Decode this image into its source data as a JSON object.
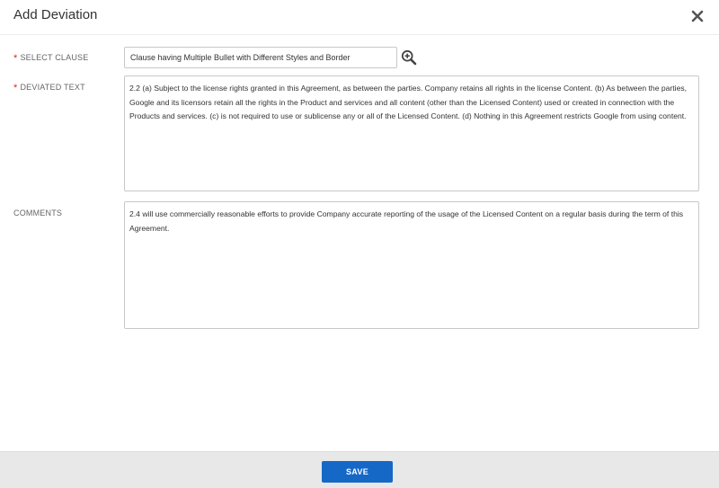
{
  "dialog": {
    "title": "Add Deviation",
    "close_icon": "close-icon"
  },
  "fields": {
    "select_clause": {
      "label": "SELECT CLAUSE",
      "required": "*",
      "value": "Clause having Multiple Bullet with Different Styles and Border",
      "lookup_icon": "zoom-in-icon"
    },
    "deviated_text": {
      "label": "DEVIATED TEXT",
      "required": "*",
      "value": "2.2 (a) Subject to the license rights granted in this Agreement, as between the parties. Company retains all rights in the license Content. (b) As between the parties, Google and its licensors retain all the rights in the Product and services and all content (other than the Licensed Content) used or created in connection with the Products and services. (c) is not required to use or sublicense any or all of the Licensed Content. (d) Nothing in this Agreement restricts Google from using content."
    },
    "comments": {
      "label": "COMMENTS",
      "value": "2.4 will use commercially reasonable efforts to provide Company accurate reporting of the usage of the Licensed Content on a regular basis during the term of this Agreement."
    }
  },
  "footer": {
    "save_label": "SAVE"
  },
  "colors": {
    "accent": "#1668c7",
    "required": "#d9251c",
    "footer_bg": "#e8e8e8"
  }
}
